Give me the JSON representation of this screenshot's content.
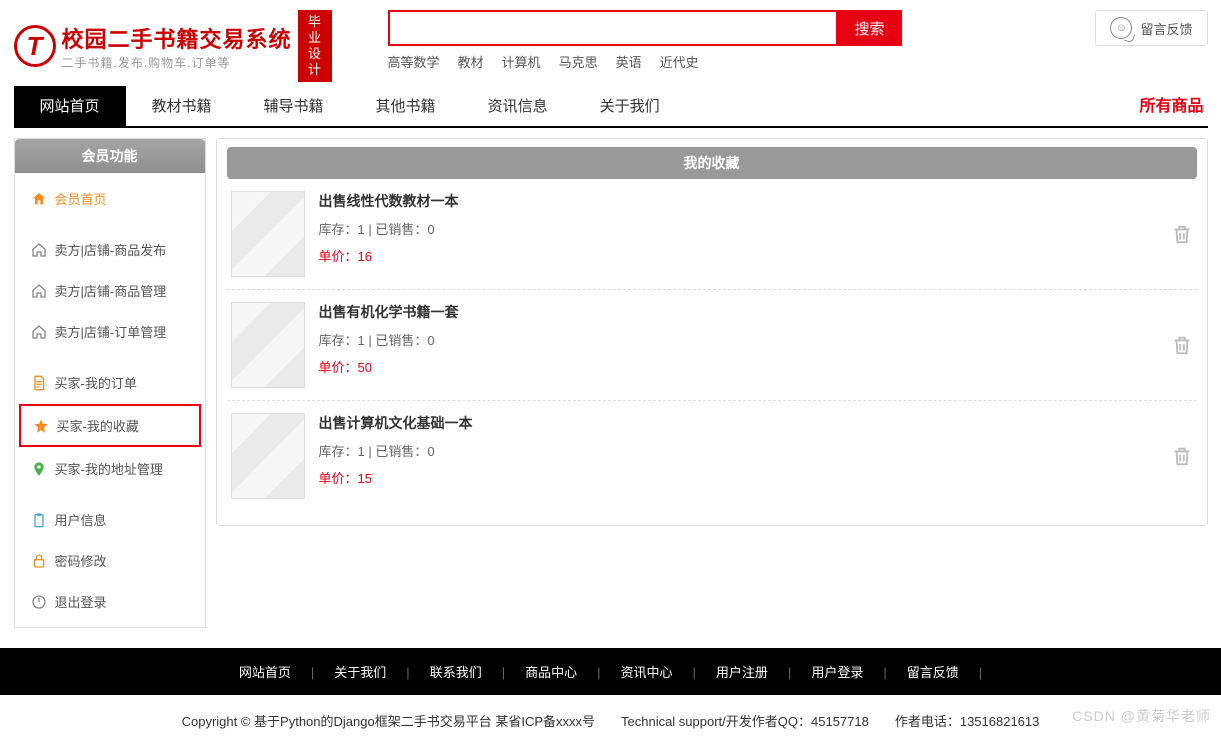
{
  "header": {
    "logo_title": "校园二手书籍交易系统",
    "logo_subtitle": "二手书籍.发布.购物车.订单等",
    "logo_badge": "毕业设计",
    "search_button": "搜索",
    "hot_keywords": [
      "高等数学",
      "教材",
      "计算机",
      "马克思",
      "英语",
      "近代史"
    ],
    "feedback_label": "留言反馈"
  },
  "nav": {
    "items": [
      "网站首页",
      "教材书籍",
      "辅导书籍",
      "其他书籍",
      "资讯信息",
      "关于我们"
    ],
    "active_index": 0,
    "right_link": "所有商品"
  },
  "sidebar": {
    "header": "会员功能",
    "groups": [
      [
        {
          "icon": "home-orange",
          "label": "会员首页",
          "active": false,
          "color": "#f68b1f"
        }
      ],
      [
        {
          "icon": "home-outline",
          "label": "卖方|店铺-商品发布"
        },
        {
          "icon": "home-outline",
          "label": "卖方|店铺-商品管理"
        },
        {
          "icon": "home-outline",
          "label": "卖方|店铺-订单管理"
        }
      ],
      [
        {
          "icon": "doc",
          "label": "买家-我的订单"
        },
        {
          "icon": "star",
          "label": "买家-我的收藏",
          "highlight": true
        },
        {
          "icon": "location",
          "label": "买家-我的地址管理"
        }
      ],
      [
        {
          "icon": "clipboard",
          "label": "用户信息"
        },
        {
          "icon": "lock",
          "label": "密码修改"
        },
        {
          "icon": "power",
          "label": "退出登录"
        }
      ]
    ]
  },
  "content": {
    "title": "我的收藏",
    "favorites": [
      {
        "title": "出售线性代数教材一本",
        "stock_label": "库存",
        "stock": 1,
        "sold_label": "已销售",
        "sold": 0,
        "price_label": "单价",
        "price": 16
      },
      {
        "title": "出售有机化学书籍一套",
        "stock_label": "库存",
        "stock": 1,
        "sold_label": "已销售",
        "sold": 0,
        "price_label": "单价",
        "price": 50
      },
      {
        "title": "出售计算机文化基础一本",
        "stock_label": "库存",
        "stock": 1,
        "sold_label": "已销售",
        "sold": 0,
        "price_label": "单价",
        "price": 15
      }
    ]
  },
  "footer": {
    "links": [
      "网站首页",
      "关于我们",
      "联系我们",
      "商品中心",
      "资讯中心",
      "用户注册",
      "用户登录",
      "留言反馈"
    ],
    "copyright": "Copyright © 基于Python的Django框架二手书交易平台 某省ICP备xxxx号　　Technical support/开发作者QQ：45157718　　作者电话：13516821613",
    "watermark": "CSDN @黄菊华老师"
  }
}
